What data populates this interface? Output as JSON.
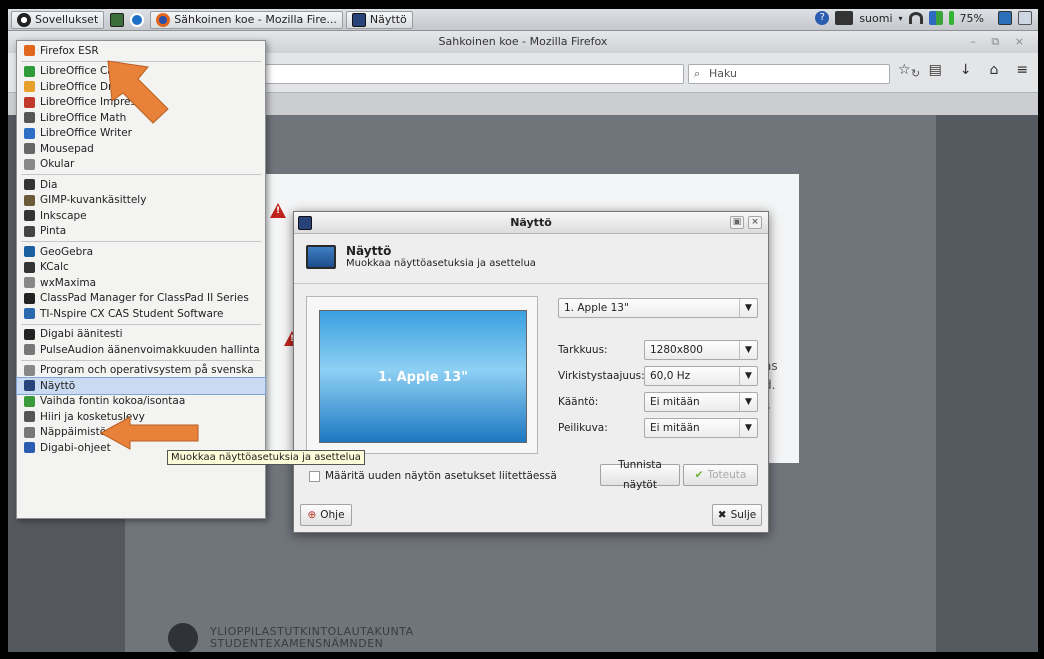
{
  "taskbar": {
    "apps_label": "Sovellukset",
    "firefox_task": "Sähkoinen koe - Mozilla Fire...",
    "display_task": "Näyttö",
    "keyboard_layout": "suomi",
    "battery": "75%"
  },
  "firefox": {
    "window_title": "Sahkoinen koe - Mozilla Firefox",
    "search_placeholder": "Haku"
  },
  "background_text": {
    "line1": "as",
    "line2": "d.",
    "line3": "s"
  },
  "footer": {
    "line1": "YLIOPPILASTUTKINTOLAUTAKUNTA",
    "line2": "STUDENTEXAMENSNÄMNDEN"
  },
  "menu": {
    "items": [
      {
        "label": "Firefox ESR",
        "icon": "firefox-icon"
      },
      {
        "label": "LibreOffice Calc",
        "icon": "calc-icon"
      },
      {
        "label": "LibreOffice Draw",
        "icon": "draw-icon"
      },
      {
        "label": "LibreOffice Impress",
        "icon": "impress-icon"
      },
      {
        "label": "LibreOffice Math",
        "icon": "math-icon"
      },
      {
        "label": "LibreOffice Writer",
        "icon": "writer-icon"
      },
      {
        "label": "Mousepad",
        "icon": "mousepad-icon"
      },
      {
        "label": "Okular",
        "icon": "okular-icon"
      },
      {
        "label": "Dia",
        "icon": "dia-icon"
      },
      {
        "label": "GIMP-kuvankäsittely",
        "icon": "gimp-icon"
      },
      {
        "label": "Inkscape",
        "icon": "inkscape-icon"
      },
      {
        "label": "Pinta",
        "icon": "pinta-icon"
      },
      {
        "label": "GeoGebra",
        "icon": "geogebra-icon"
      },
      {
        "label": "KCalc",
        "icon": "kcalc-icon"
      },
      {
        "label": "wxMaxima",
        "icon": "wxmaxima-icon"
      },
      {
        "label": "ClassPad Manager for ClassPad II Series",
        "icon": "classpad-icon"
      },
      {
        "label": "TI-Nspire CX CAS Student Software",
        "icon": "tinspire-icon"
      },
      {
        "label": "Digabi äänitesti",
        "icon": "headphones-icon"
      },
      {
        "label": "PulseAudion äänenvoimakkuuden hallinta",
        "icon": "volume-icon"
      },
      {
        "label": "Program och operativsystem på svenska",
        "icon": "speech-icon"
      },
      {
        "label": "Näyttö",
        "icon": "display-icon"
      },
      {
        "label": "Vaihda fontin kokoa/isontaa",
        "icon": "font-icon"
      },
      {
        "label": "Hiiri ja kosketuslevy",
        "icon": "mouse-icon"
      },
      {
        "label": "Näppäimistö",
        "icon": "keyboard-icon"
      },
      {
        "label": "Digabi-ohjeet",
        "icon": "help-icon"
      }
    ],
    "tooltip": "Muokkaa näyttöasetuksia ja asettelua"
  },
  "dialog": {
    "title": "Näyttö",
    "heading": "Näyttö",
    "subheading": "Muokkaa näyttöasetuksia ja asettelua",
    "preview_label": "1. Apple 13\"",
    "monitor_select": "1. Apple 13\"",
    "resolution_label": "Tarkkuus:",
    "resolution_value": "1280x800",
    "refresh_label": "Virkistystaajuus:",
    "refresh_value": "60,0 Hz",
    "rotation_label": "Kääntö:",
    "rotation_value": "Ei mitään",
    "mirror_label": "Peilikuva:",
    "mirror_value": "Ei mitään",
    "checkbox_label": "Määritä uuden näytön asetukset liitettäessä",
    "identify_button": "Tunnista näytöt",
    "apply_button": "Toteuta",
    "help_button": "Ohje",
    "close_button": "Sulje"
  },
  "colors": {
    "arrow": "#e8813a",
    "selection": "#c9daf1",
    "warning": "#c0241c"
  }
}
